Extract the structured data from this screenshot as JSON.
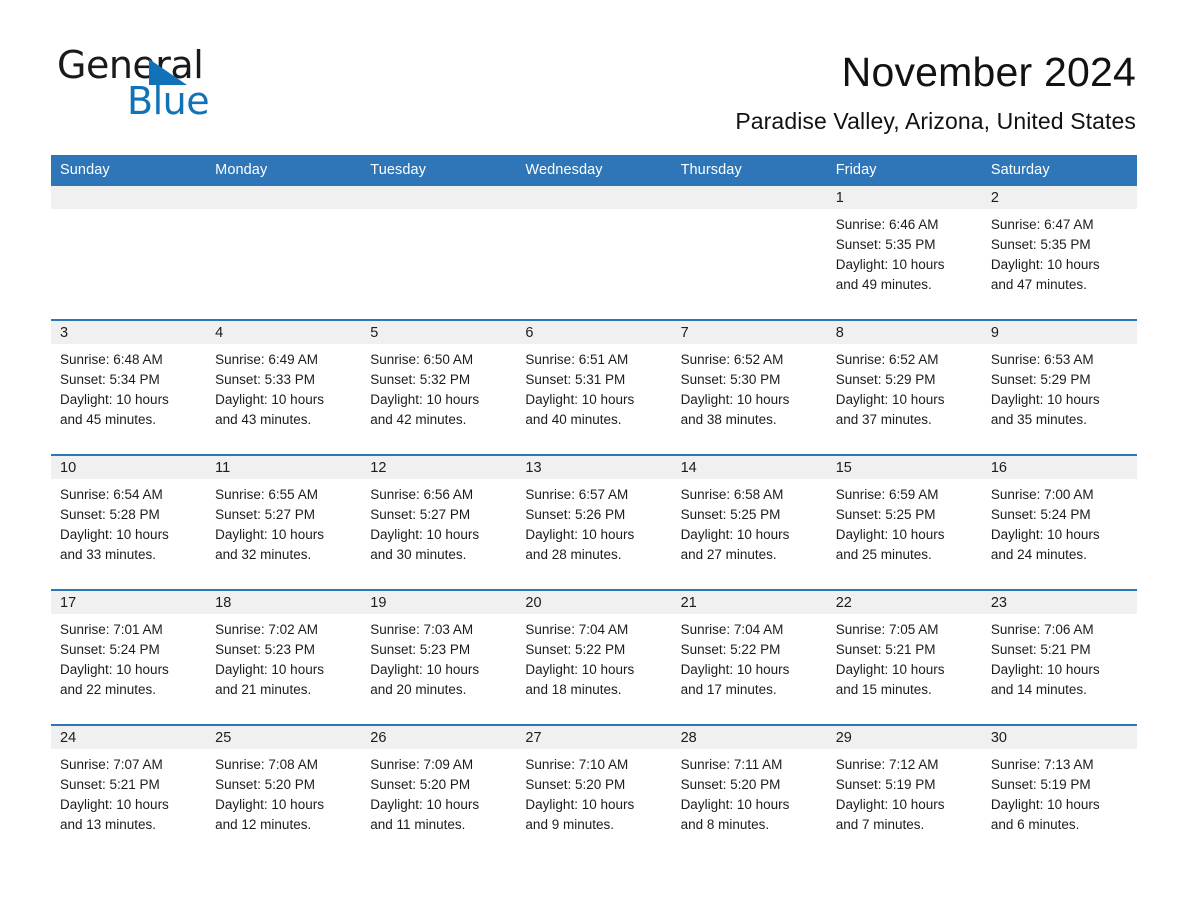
{
  "brand": {
    "name_part1": "General",
    "name_part2": "Blue",
    "accent_color": "#1272b8"
  },
  "header": {
    "month_title": "November 2024",
    "location": "Paradise Valley, Arizona, United States"
  },
  "theme": {
    "header_bg": "#2e76b8",
    "daynum_bg": "#f0f0f0",
    "row_border": "#2e76b8",
    "text": "#1c1c1c"
  },
  "weekday_headers": [
    "Sunday",
    "Monday",
    "Tuesday",
    "Wednesday",
    "Thursday",
    "Friday",
    "Saturday"
  ],
  "weeks": [
    [
      {
        "day": "",
        "empty": true
      },
      {
        "day": "",
        "empty": true
      },
      {
        "day": "",
        "empty": true
      },
      {
        "day": "",
        "empty": true
      },
      {
        "day": "",
        "empty": true
      },
      {
        "day": "1",
        "sunrise": "Sunrise: 6:46 AM",
        "sunset": "Sunset: 5:35 PM",
        "daylight_line1": "Daylight: 10 hours",
        "daylight_line2": "and 49 minutes."
      },
      {
        "day": "2",
        "sunrise": "Sunrise: 6:47 AM",
        "sunset": "Sunset: 5:35 PM",
        "daylight_line1": "Daylight: 10 hours",
        "daylight_line2": "and 47 minutes."
      }
    ],
    [
      {
        "day": "3",
        "sunrise": "Sunrise: 6:48 AM",
        "sunset": "Sunset: 5:34 PM",
        "daylight_line1": "Daylight: 10 hours",
        "daylight_line2": "and 45 minutes."
      },
      {
        "day": "4",
        "sunrise": "Sunrise: 6:49 AM",
        "sunset": "Sunset: 5:33 PM",
        "daylight_line1": "Daylight: 10 hours",
        "daylight_line2": "and 43 minutes."
      },
      {
        "day": "5",
        "sunrise": "Sunrise: 6:50 AM",
        "sunset": "Sunset: 5:32 PM",
        "daylight_line1": "Daylight: 10 hours",
        "daylight_line2": "and 42 minutes."
      },
      {
        "day": "6",
        "sunrise": "Sunrise: 6:51 AM",
        "sunset": "Sunset: 5:31 PM",
        "daylight_line1": "Daylight: 10 hours",
        "daylight_line2": "and 40 minutes."
      },
      {
        "day": "7",
        "sunrise": "Sunrise: 6:52 AM",
        "sunset": "Sunset: 5:30 PM",
        "daylight_line1": "Daylight: 10 hours",
        "daylight_line2": "and 38 minutes."
      },
      {
        "day": "8",
        "sunrise": "Sunrise: 6:52 AM",
        "sunset": "Sunset: 5:29 PM",
        "daylight_line1": "Daylight: 10 hours",
        "daylight_line2": "and 37 minutes."
      },
      {
        "day": "9",
        "sunrise": "Sunrise: 6:53 AM",
        "sunset": "Sunset: 5:29 PM",
        "daylight_line1": "Daylight: 10 hours",
        "daylight_line2": "and 35 minutes."
      }
    ],
    [
      {
        "day": "10",
        "sunrise": "Sunrise: 6:54 AM",
        "sunset": "Sunset: 5:28 PM",
        "daylight_line1": "Daylight: 10 hours",
        "daylight_line2": "and 33 minutes."
      },
      {
        "day": "11",
        "sunrise": "Sunrise: 6:55 AM",
        "sunset": "Sunset: 5:27 PM",
        "daylight_line1": "Daylight: 10 hours",
        "daylight_line2": "and 32 minutes."
      },
      {
        "day": "12",
        "sunrise": "Sunrise: 6:56 AM",
        "sunset": "Sunset: 5:27 PM",
        "daylight_line1": "Daylight: 10 hours",
        "daylight_line2": "and 30 minutes."
      },
      {
        "day": "13",
        "sunrise": "Sunrise: 6:57 AM",
        "sunset": "Sunset: 5:26 PM",
        "daylight_line1": "Daylight: 10 hours",
        "daylight_line2": "and 28 minutes."
      },
      {
        "day": "14",
        "sunrise": "Sunrise: 6:58 AM",
        "sunset": "Sunset: 5:25 PM",
        "daylight_line1": "Daylight: 10 hours",
        "daylight_line2": "and 27 minutes."
      },
      {
        "day": "15",
        "sunrise": "Sunrise: 6:59 AM",
        "sunset": "Sunset: 5:25 PM",
        "daylight_line1": "Daylight: 10 hours",
        "daylight_line2": "and 25 minutes."
      },
      {
        "day": "16",
        "sunrise": "Sunrise: 7:00 AM",
        "sunset": "Sunset: 5:24 PM",
        "daylight_line1": "Daylight: 10 hours",
        "daylight_line2": "and 24 minutes."
      }
    ],
    [
      {
        "day": "17",
        "sunrise": "Sunrise: 7:01 AM",
        "sunset": "Sunset: 5:24 PM",
        "daylight_line1": "Daylight: 10 hours",
        "daylight_line2": "and 22 minutes."
      },
      {
        "day": "18",
        "sunrise": "Sunrise: 7:02 AM",
        "sunset": "Sunset: 5:23 PM",
        "daylight_line1": "Daylight: 10 hours",
        "daylight_line2": "and 21 minutes."
      },
      {
        "day": "19",
        "sunrise": "Sunrise: 7:03 AM",
        "sunset": "Sunset: 5:23 PM",
        "daylight_line1": "Daylight: 10 hours",
        "daylight_line2": "and 20 minutes."
      },
      {
        "day": "20",
        "sunrise": "Sunrise: 7:04 AM",
        "sunset": "Sunset: 5:22 PM",
        "daylight_line1": "Daylight: 10 hours",
        "daylight_line2": "and 18 minutes."
      },
      {
        "day": "21",
        "sunrise": "Sunrise: 7:04 AM",
        "sunset": "Sunset: 5:22 PM",
        "daylight_line1": "Daylight: 10 hours",
        "daylight_line2": "and 17 minutes."
      },
      {
        "day": "22",
        "sunrise": "Sunrise: 7:05 AM",
        "sunset": "Sunset: 5:21 PM",
        "daylight_line1": "Daylight: 10 hours",
        "daylight_line2": "and 15 minutes."
      },
      {
        "day": "23",
        "sunrise": "Sunrise: 7:06 AM",
        "sunset": "Sunset: 5:21 PM",
        "daylight_line1": "Daylight: 10 hours",
        "daylight_line2": "and 14 minutes."
      }
    ],
    [
      {
        "day": "24",
        "sunrise": "Sunrise: 7:07 AM",
        "sunset": "Sunset: 5:21 PM",
        "daylight_line1": "Daylight: 10 hours",
        "daylight_line2": "and 13 minutes."
      },
      {
        "day": "25",
        "sunrise": "Sunrise: 7:08 AM",
        "sunset": "Sunset: 5:20 PM",
        "daylight_line1": "Daylight: 10 hours",
        "daylight_line2": "and 12 minutes."
      },
      {
        "day": "26",
        "sunrise": "Sunrise: 7:09 AM",
        "sunset": "Sunset: 5:20 PM",
        "daylight_line1": "Daylight: 10 hours",
        "daylight_line2": "and 11 minutes."
      },
      {
        "day": "27",
        "sunrise": "Sunrise: 7:10 AM",
        "sunset": "Sunset: 5:20 PM",
        "daylight_line1": "Daylight: 10 hours",
        "daylight_line2": "and 9 minutes."
      },
      {
        "day": "28",
        "sunrise": "Sunrise: 7:11 AM",
        "sunset": "Sunset: 5:20 PM",
        "daylight_line1": "Daylight: 10 hours",
        "daylight_line2": "and 8 minutes."
      },
      {
        "day": "29",
        "sunrise": "Sunrise: 7:12 AM",
        "sunset": "Sunset: 5:19 PM",
        "daylight_line1": "Daylight: 10 hours",
        "daylight_line2": "and 7 minutes."
      },
      {
        "day": "30",
        "sunrise": "Sunrise: 7:13 AM",
        "sunset": "Sunset: 5:19 PM",
        "daylight_line1": "Daylight: 10 hours",
        "daylight_line2": "and 6 minutes."
      }
    ]
  ]
}
